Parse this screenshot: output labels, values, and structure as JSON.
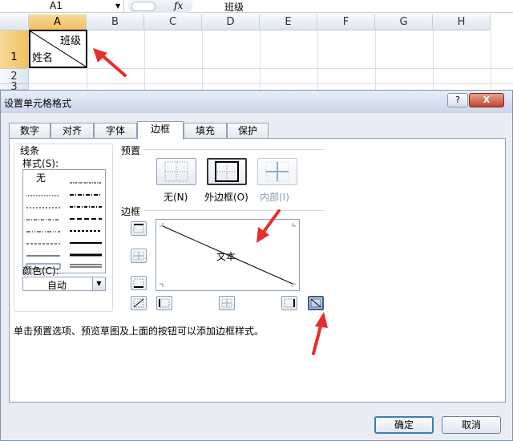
{
  "formula_bar": {
    "name_box": "A1",
    "fx": "fx",
    "content": "班级"
  },
  "sheet": {
    "columns": [
      "A",
      "B",
      "C",
      "D",
      "E",
      "F",
      "G",
      "H"
    ],
    "rows": [
      "1",
      "2",
      "3"
    ],
    "cell_a1": {
      "top_right": "班级",
      "bottom_left": "姓名"
    }
  },
  "dialog": {
    "title": "设置单元格格式",
    "help": "?",
    "close": "X",
    "tabs": [
      "数字",
      "对齐",
      "字体",
      "边框",
      "填充",
      "保护"
    ],
    "active_tab": "边框",
    "line_group": "线条",
    "style_label": "样式(S):",
    "style_none": "无",
    "color_label": "颜色(C):",
    "color_value": "自动",
    "presets_label": "预置",
    "presets": [
      "无(N)",
      "外边框(O)",
      "内部(I)"
    ],
    "border_label": "边框",
    "preview_text": "文本",
    "hint": "单击预置选项、预览草图及上面的按钮可以添加边框样式。",
    "ok": "确定",
    "cancel": "取消",
    "accent": "#e52e2e"
  }
}
